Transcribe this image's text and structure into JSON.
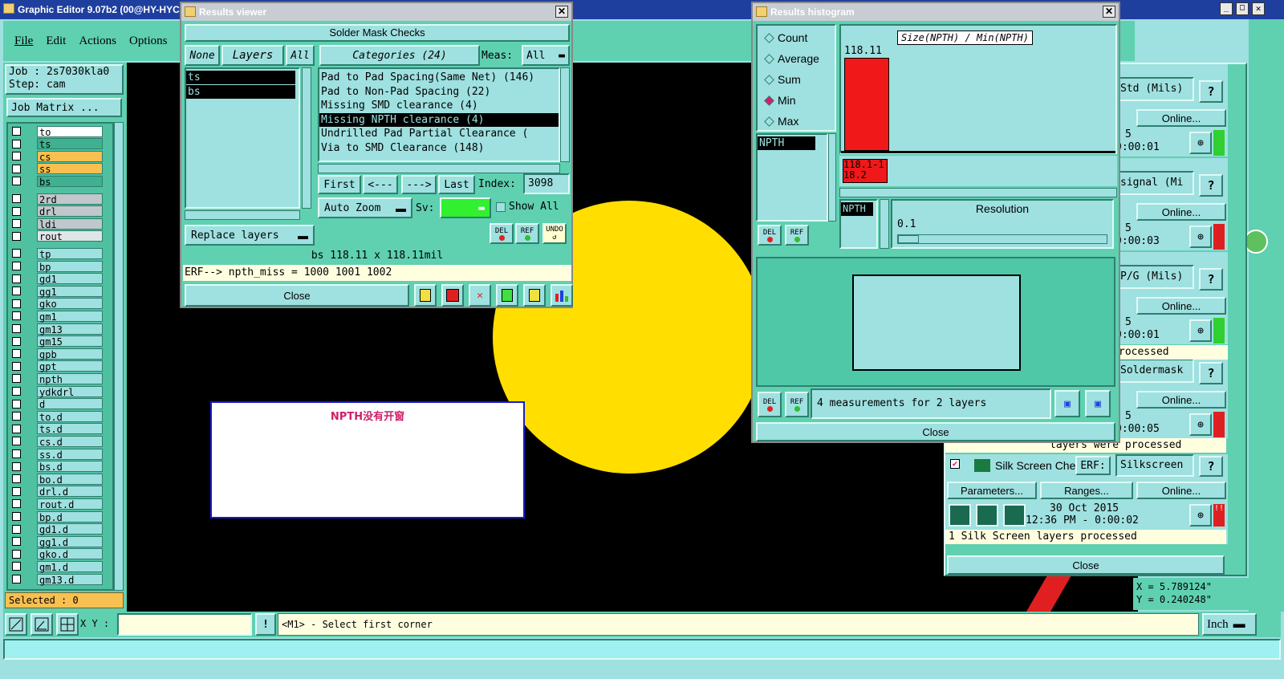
{
  "main_window": {
    "title": "Graphic Editor 9.07b2 (00@HY-HYCA",
    "menu": [
      "File",
      "Edit",
      "Actions",
      "Options"
    ],
    "job": "Job : 2s7030kla0",
    "step": "Step: cam",
    "job_matrix": "Job Matrix ...",
    "selected": "Selected : 0"
  },
  "layers": {
    "group1": [
      {
        "name": "to",
        "color": "#ffffff"
      },
      {
        "name": "ts",
        "color": "#3fb090"
      },
      {
        "name": "cs",
        "color": "#f8c050"
      },
      {
        "name": "ss",
        "color": "#f8c050"
      },
      {
        "name": "bs",
        "color": "#3fb090"
      }
    ],
    "group2": [
      {
        "name": "2rd",
        "color": "#c0c8cc"
      },
      {
        "name": "drl",
        "color": "#c0c8cc"
      },
      {
        "name": "ldi",
        "color": "#c0c8cc"
      },
      {
        "name": "rout",
        "color": "#e0e6e8"
      }
    ],
    "group3": [
      "tp",
      "bp",
      "gd1",
      "gg1",
      "gko",
      "gm1",
      "gm13",
      "gm15",
      "gpb",
      "gpt",
      "npth",
      "ydkdrl",
      "d",
      "to.d",
      "ts.d",
      "cs.d",
      "ss.d",
      "bs.d",
      "bo.d",
      "drl.d",
      "rout.d",
      "bp.d",
      "gd1.d",
      "gg1.d",
      "gko.d",
      "gm1.d",
      "gm13.d"
    ]
  },
  "canvas": {
    "note_text": "NPTH没有开窗",
    "coord_x": "X = 5.789124\"",
    "coord_y": "Y = 0.240248\""
  },
  "bottom": {
    "xy_label": "X Y :",
    "xy_value": "",
    "prompt": "<M1> - Select first corner",
    "units": "Inch"
  },
  "results_viewer": {
    "title": "Results viewer",
    "header": "Solder Mask Checks",
    "btn_none": "None",
    "btn_layers": "Layers",
    "btn_all": "All",
    "categories_label": "Categories (24)",
    "meas_label": "Meas:",
    "meas_value": "All",
    "layer_items": [
      "ts",
      "bs"
    ],
    "category_items": [
      "Pad to Pad Spacing(Same Net) (146)",
      "Pad to Non-Pad Spacing (22)",
      "Missing SMD clearance (4)",
      "Missing NPTH clearance (4)",
      "Undrilled Pad Partial Clearance (",
      "Via to SMD Clearance (148)"
    ],
    "selected_category_index": 3,
    "nav": [
      "First",
      "<---",
      "--->",
      "Last"
    ],
    "index_label": "Index:",
    "index_value": "3098",
    "auto_zoom": "Auto Zoom",
    "sv_label": "Sv:",
    "show_all": "Show All",
    "replace_layers": "Replace layers",
    "status": "bs 118.11 x 118.11mil",
    "erf": "ERF--> npth_miss = 1000 1001 1002",
    "close": "Close",
    "del": "DEL",
    "ref": "REF",
    "undo": "UNDO"
  },
  "histogram": {
    "title": "Results histogram",
    "options": [
      "Count",
      "Average",
      "Sum",
      "Min",
      "Max"
    ],
    "selected_option": "Min",
    "formula": "Size(NPTH) / Min(NPTH)",
    "bar_value": "118.11",
    "bar_range": "118.1-118.2",
    "bar_fraction": 1.0,
    "list_item": "NPTH",
    "side_label": "NPTH",
    "resolution_label": "Resolution",
    "resolution_value": "0.1",
    "measurements": "4 measurements for 2 layers",
    "close": "Close",
    "del": "DEL",
    "ref": "REF"
  },
  "checklist": {
    "rows": [
      {
        "partial_name": "Std (Mils)",
        "time": "0:00:01",
        "status": "green"
      },
      {
        "partial_name": "signal (Mi",
        "time": "0:00:03",
        "status": "red"
      },
      {
        "partial_name": "P/G (Mils)",
        "time": "0:00:01",
        "status": "green"
      },
      {
        "partial_name": "Soldermask",
        "time": "0:00:05",
        "status": "red"
      }
    ],
    "processed_text": "rocessed",
    "processed_text2": "layers were processed",
    "silk_name": "Silk Screen Che",
    "erf": "ERF:",
    "silk_value": "Silkscreen",
    "parameters": "Parameters...",
    "ranges": "Ranges...",
    "online": "Online...",
    "date": "30 Oct 2015",
    "time_line": "12:36 PM - 0:00:02",
    "silk_processed": "1 Silk Screen layers processed",
    "close": "Close",
    "num5": "5"
  }
}
